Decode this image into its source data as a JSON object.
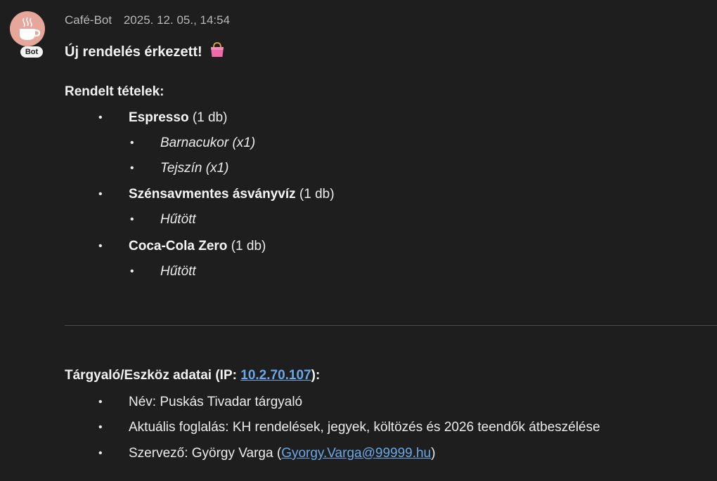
{
  "message": {
    "sender": "Café-Bot",
    "timestamp": "2025. 12. 05., 14:54",
    "badge": "Bot",
    "title": "Új rendelés érkezett!",
    "title_icon": "shopping-bag-icon"
  },
  "order": {
    "heading": "Rendelt tételek:",
    "items": [
      {
        "name": "Espresso",
        "qty": "(1 db)",
        "options": [
          "Barnacukor (x1)",
          "Tejszín (x1)"
        ]
      },
      {
        "name": "Szénsavmentes ásványvíz",
        "qty": "(1 db)",
        "options": [
          "Hűtött"
        ]
      },
      {
        "name": "Coca-Cola Zero",
        "qty": "(1 db)",
        "options": [
          "Hűtött"
        ]
      }
    ]
  },
  "device": {
    "heading_prefix": "Tárgyaló/Eszköz adatai (IP: ",
    "ip": "10.2.70.107",
    "heading_suffix": "):",
    "name_line": "Név: Puskás Tivadar tárgyaló",
    "booking_line": "Aktuális foglalás: KH rendelések, jegyek, költözés és 2026 teendők átbeszélése",
    "organizer_prefix": "Szervező: György Varga (",
    "organizer_email": "Gyorgy.Varga@99999.hu",
    "organizer_suffix": ")"
  },
  "colors": {
    "background": "#1e1e1f",
    "link": "#6aa8e8",
    "avatar": "#e6a79a"
  }
}
